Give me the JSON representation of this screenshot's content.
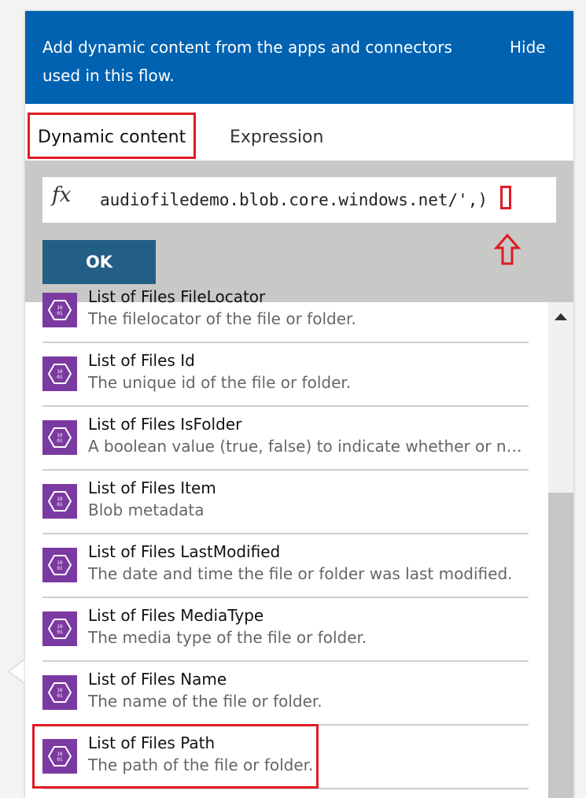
{
  "header": {
    "text": "Add dynamic content from the apps and connectors used in this flow.",
    "hide_label": "Hide"
  },
  "tabs": [
    {
      "label": "Dynamic content",
      "selected": true
    },
    {
      "label": "Expression",
      "selected": false
    }
  ],
  "expression": {
    "fx_label": "fx",
    "value": "audiofiledemo.blob.core.windows.net/',)",
    "ok_label": "OK"
  },
  "items": [
    {
      "title": "List of Files FileLocator",
      "description": "The filelocator of the file or folder."
    },
    {
      "title": "List of Files Id",
      "description": "The unique id of the file or folder."
    },
    {
      "title": "List of Files IsFolder",
      "description": "A boolean value (true, false) to indicate whether or not the blob is a folder."
    },
    {
      "title": "List of Files Item",
      "description": "Blob metadata"
    },
    {
      "title": "List of Files LastModified",
      "description": "The date and time the file or folder was last modified."
    },
    {
      "title": "List of Files MediaType",
      "description": "The media type of the file or folder."
    },
    {
      "title": "List of Files Name",
      "description": "The name of the file or folder."
    },
    {
      "title": "List of Files Path",
      "description": "The path of the file or folder."
    }
  ],
  "icon_name": "blob-storage-icon",
  "colors": {
    "header_bg": "#0062b1",
    "ok_button": "#235f84",
    "icon_bg": "#7b3aa1",
    "highlight": "#e01b24"
  }
}
